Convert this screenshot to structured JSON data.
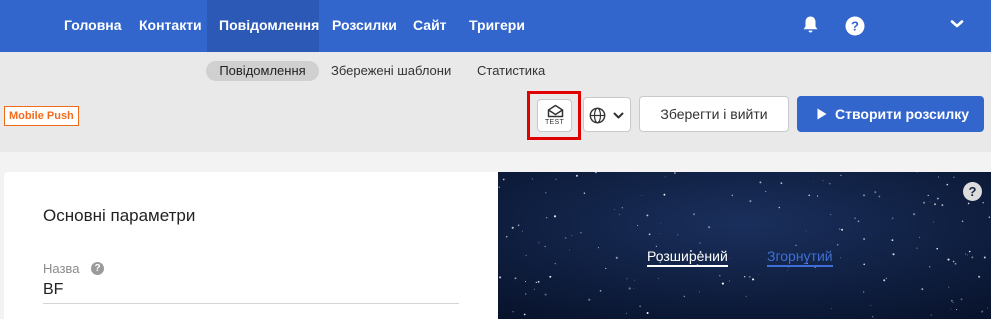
{
  "nav": {
    "items": [
      {
        "label": "Головна"
      },
      {
        "label": "Контакти"
      },
      {
        "label": "Повідомлення",
        "active": true
      },
      {
        "label": "Розсилки"
      },
      {
        "label": "Сайт"
      },
      {
        "label": "Тригери"
      }
    ],
    "icons": [
      "bell-icon",
      "help-icon",
      "chevron-down-icon"
    ]
  },
  "subnav": {
    "items": [
      {
        "label": "Повідомлення",
        "active": true
      },
      {
        "label": "Збережені шаблони"
      },
      {
        "label": "Статистика"
      }
    ]
  },
  "toolbar": {
    "channel_badge": "Mobile Push",
    "test_label": "TEST",
    "save_label": "Зберегти і вийти",
    "create_label": "Створити розсилку"
  },
  "main": {
    "section_title": "Основні параметри",
    "name_label": "Назва",
    "name_value": "BF"
  },
  "preview": {
    "tabs": [
      {
        "label": "Розширений",
        "active": true
      },
      {
        "label": "Згорнутий"
      }
    ]
  },
  "colors": {
    "brand_blue": "#3366cc",
    "nav_active": "#2b59b5",
    "badge_orange": "#f26b1d",
    "highlight_red": "#e00000",
    "preview_bg": "#0c1a3a"
  }
}
